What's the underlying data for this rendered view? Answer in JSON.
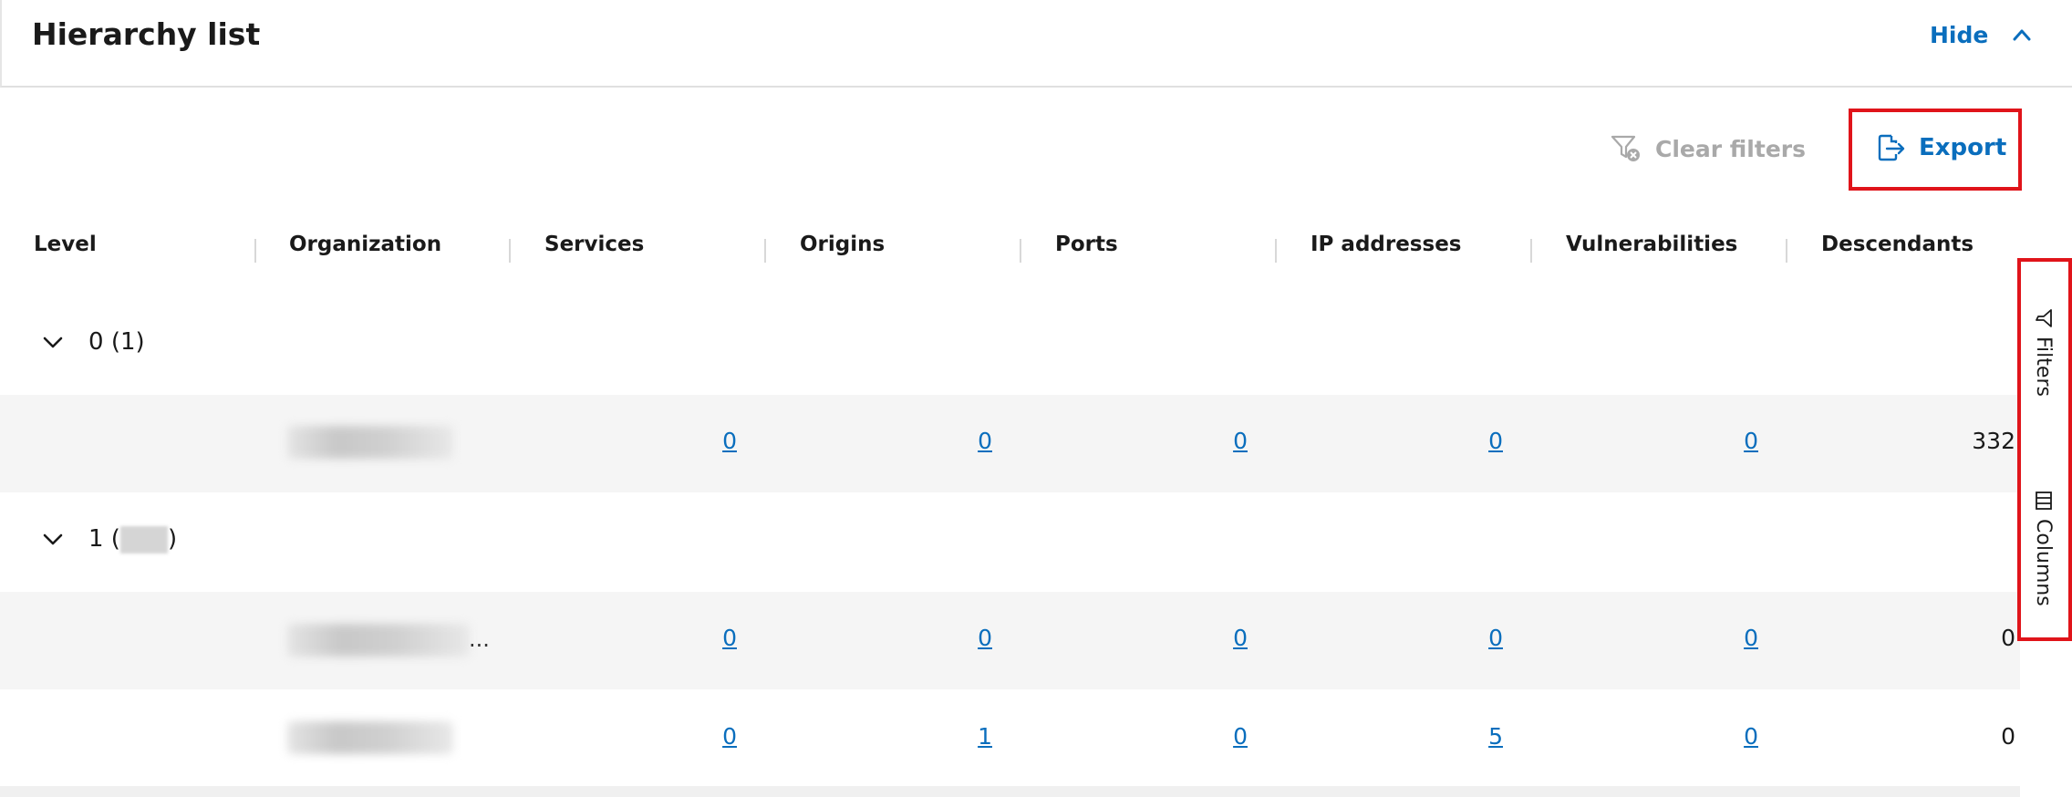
{
  "header": {
    "title": "Hierarchy list",
    "hide_label": "Hide"
  },
  "toolbar": {
    "clear_filters_label": "Clear filters",
    "export_label": "Export"
  },
  "columns": [
    "Level",
    "Organization",
    "Services",
    "Origins",
    "Ports",
    "IP addresses",
    "Vulnerabilities",
    "Descendants"
  ],
  "groups": [
    {
      "label_prefix": "0",
      "count_text": "(1)"
    },
    {
      "label_prefix": "1 (",
      "count_suffix": ")"
    }
  ],
  "rows": [
    {
      "services": "0",
      "origins": "0",
      "ports": "0",
      "ip_addresses": "0",
      "vulnerabilities": "0",
      "descendants": "332"
    },
    {
      "ellipsis": "...",
      "services": "0",
      "origins": "0",
      "ports": "0",
      "ip_addresses": "0",
      "vulnerabilities": "0",
      "descendants": "0"
    },
    {
      "services": "0",
      "origins": "1",
      "ports": "0",
      "ip_addresses": "5",
      "vulnerabilities": "0",
      "descendants": "0"
    }
  ],
  "side_panel": {
    "filters_label": "Filters",
    "columns_label": "Columns"
  },
  "colors": {
    "accent": "#0a6ebd",
    "highlight_border": "#e0141a",
    "row_shade": "#f5f5f5",
    "disabled": "#a9a9a9"
  },
  "icons": {
    "collapse": "chevron-up-icon",
    "expand": "chevron-down-icon",
    "clear_filters": "filter-clear-icon",
    "export": "export-icon",
    "filters": "filter-icon",
    "columns": "columns-icon"
  }
}
